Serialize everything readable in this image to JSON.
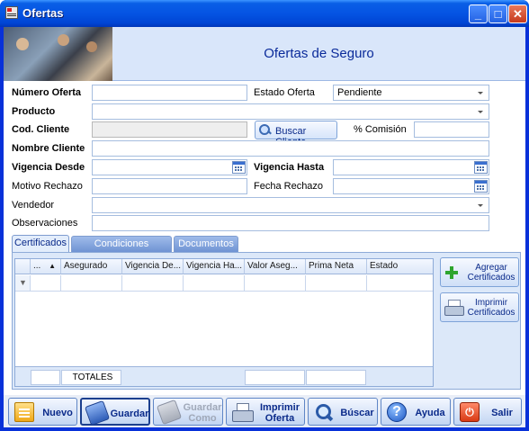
{
  "window": {
    "title": "Ofertas"
  },
  "header": {
    "title": "Ofertas de Seguro"
  },
  "form": {
    "numero_oferta": {
      "label": "Número Oferta",
      "value": ""
    },
    "estado_oferta": {
      "label": "Estado Oferta",
      "value": "Pendiente"
    },
    "producto": {
      "label": "Producto",
      "value": ""
    },
    "cod_cliente": {
      "label": "Cod. Cliente",
      "value": ""
    },
    "buscar_cliente": "Buscar Cliente",
    "comision": {
      "label": "% Comisión",
      "value": ""
    },
    "nombre_cliente": {
      "label": "Nombre Cliente",
      "value": ""
    },
    "vigencia_desde": {
      "label": "Vigencia Desde",
      "value": ""
    },
    "vigencia_hasta": {
      "label": "Vigencia Hasta",
      "value": ""
    },
    "motivo_rechazo": {
      "label": "Motivo Rechazo",
      "value": ""
    },
    "fecha_rechazo": {
      "label": "Fecha Rechazo",
      "value": ""
    },
    "vendedor": {
      "label": "Vendedor",
      "value": ""
    },
    "observaciones": {
      "label": "Observaciones",
      "value": ""
    }
  },
  "tabs": [
    {
      "label": "Certificados",
      "active": true
    },
    {
      "label": "Condiciones Especiales",
      "active": false
    },
    {
      "label": "Documentos",
      "active": false
    }
  ],
  "grid": {
    "columns": [
      "...",
      "Asegurado",
      "Vigencia De...",
      "Vigencia Ha...",
      "Valor Aseg...",
      "Prima Neta",
      "Estado"
    ],
    "totals_label": "TOTALES"
  },
  "side_buttons": {
    "agregar": "Agregar Certificados",
    "imprimir": "Imprimir Certificados"
  },
  "toolbar": {
    "nuevo": "Nuevo",
    "guardar": "Guardar",
    "guardar_como": "Guardar Como",
    "imprimir_oferta": "Imprimir Oferta",
    "buscar": "Búscar",
    "ayuda": "Ayuda",
    "salir": "Salir"
  },
  "colors": {
    "titlebar": "#0554e3",
    "header_bg": "#d9e6fa",
    "header_title": "#0a2a9a",
    "accent_green": "#2ea52e"
  }
}
